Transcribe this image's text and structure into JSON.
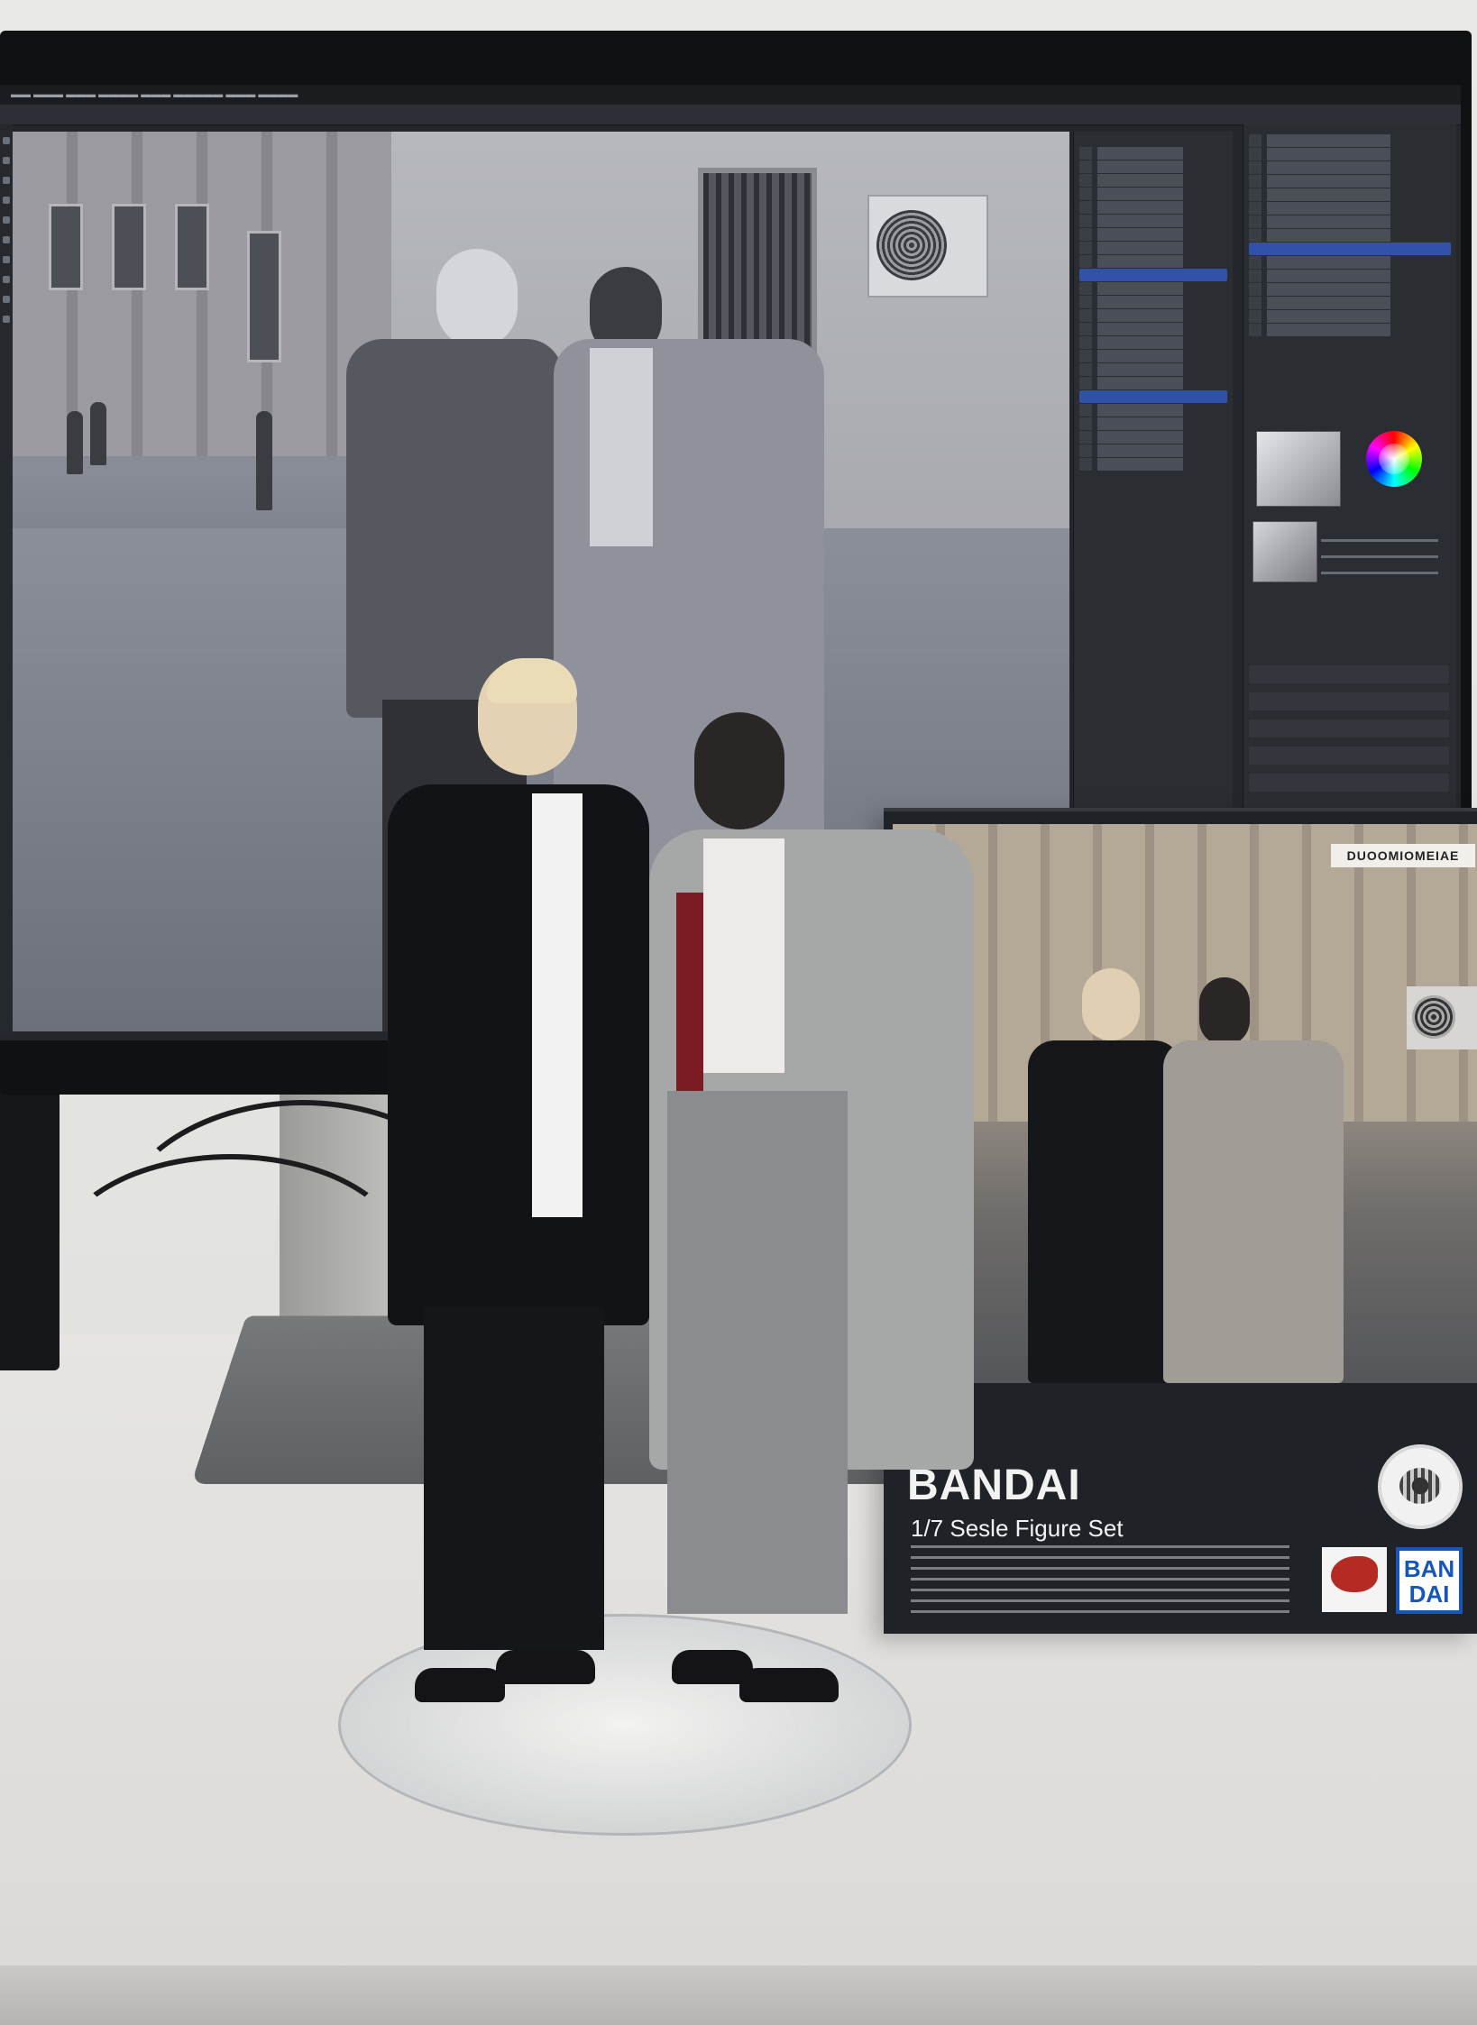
{
  "scene": {
    "description_tags": [
      "monitor",
      "photo-editor",
      "figure",
      "box"
    ]
  },
  "editor": {
    "menu_items": [
      "",
      "",
      "",
      "",
      "",
      "",
      "",
      "",
      "",
      ""
    ],
    "panels": {
      "layers_rows": 24,
      "adjust_rows": 14
    }
  },
  "box": {
    "tag_text": "DUOOMIOMEIAE",
    "brand": "BANDAI",
    "title": "1/7 Sesle Figure Set",
    "logo_text_line1": "BAN",
    "logo_text_line2": "DAI"
  },
  "colors": {
    "accent": "#3152a8",
    "bandai_blue": "#1556b8",
    "logo_red": "#b52a22"
  }
}
